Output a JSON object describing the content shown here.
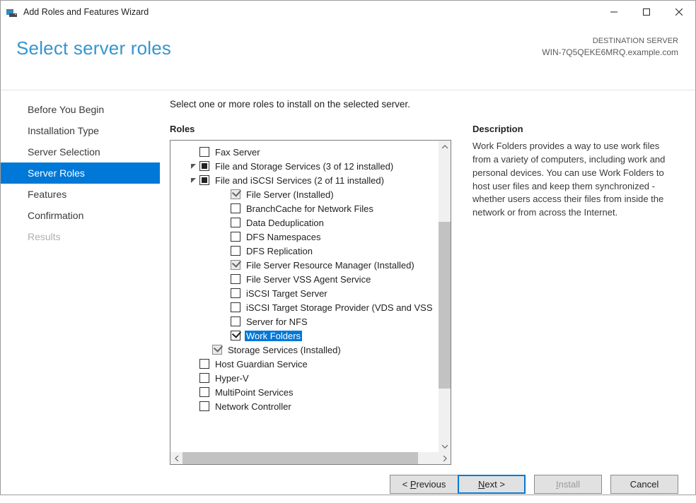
{
  "window_title": "Add Roles and Features Wizard",
  "page_title": "Select server roles",
  "destination_label": "DESTINATION SERVER",
  "destination_value": "WIN-7Q5QEKE6MRQ.example.com",
  "steps": [
    "Before You Begin",
    "Installation Type",
    "Server Selection",
    "Server Roles",
    "Features",
    "Confirmation",
    "Results"
  ],
  "active_step_index": 3,
  "disabled_step_indexes": [
    6
  ],
  "instruction": "Select one or more roles to install on the selected server.",
  "roles_heading": "Roles",
  "description_heading": "Description",
  "description_text": "Work Folders provides a way to use work files from a variety of computers, including work and personal devices. You can use Work Folders to host user files and keep them synchronized - whether users access their files from inside the network or from across the Internet.",
  "roles_tree": [
    {
      "indent": 2,
      "arrow": "none",
      "cb": "unchecked",
      "label": "Fax Server"
    },
    {
      "indent": 1,
      "arrow": "down",
      "cb": "mixed",
      "label": "File and Storage Services (3 of 12 installed)"
    },
    {
      "indent": 2,
      "arrow": "down",
      "cb": "mixed",
      "label": "File and iSCSI Services (2 of 11 installed)"
    },
    {
      "indent": 4,
      "arrow": "none",
      "cb": "checked_disabled",
      "label": "File Server (Installed)"
    },
    {
      "indent": 4,
      "arrow": "none",
      "cb": "unchecked",
      "label": "BranchCache for Network Files"
    },
    {
      "indent": 4,
      "arrow": "none",
      "cb": "unchecked",
      "label": "Data Deduplication"
    },
    {
      "indent": 4,
      "arrow": "none",
      "cb": "unchecked",
      "label": "DFS Namespaces"
    },
    {
      "indent": 4,
      "arrow": "none",
      "cb": "unchecked",
      "label": "DFS Replication"
    },
    {
      "indent": 4,
      "arrow": "none",
      "cb": "checked_disabled",
      "label": "File Server Resource Manager (Installed)"
    },
    {
      "indent": 4,
      "arrow": "none",
      "cb": "unchecked",
      "label": "File Server VSS Agent Service"
    },
    {
      "indent": 4,
      "arrow": "none",
      "cb": "unchecked",
      "label": "iSCSI Target Server"
    },
    {
      "indent": 4,
      "arrow": "none",
      "cb": "unchecked",
      "label": "iSCSI Target Storage Provider (VDS and VSS"
    },
    {
      "indent": 4,
      "arrow": "none",
      "cb": "unchecked",
      "label": "Server for NFS"
    },
    {
      "indent": 4,
      "arrow": "none",
      "cb": "checked",
      "label": "Work Folders",
      "selected": true
    },
    {
      "indent": 3,
      "arrow": "none",
      "cb": "checked_disabled",
      "label": "Storage Services (Installed)"
    },
    {
      "indent": 2,
      "arrow": "none",
      "cb": "unchecked",
      "label": "Host Guardian Service"
    },
    {
      "indent": 2,
      "arrow": "none",
      "cb": "unchecked",
      "label": "Hyper-V"
    },
    {
      "indent": 2,
      "arrow": "none",
      "cb": "unchecked",
      "label": "MultiPoint Services"
    },
    {
      "indent": 2,
      "arrow": "none",
      "cb": "unchecked",
      "label": "Network Controller"
    }
  ],
  "buttons": {
    "previous": "revious",
    "previous_prefix": "< ",
    "previous_hot": "P",
    "next": "ext >",
    "next_hot": "N",
    "install": "nstall",
    "install_hot": "I",
    "cancel": "Cancel"
  }
}
